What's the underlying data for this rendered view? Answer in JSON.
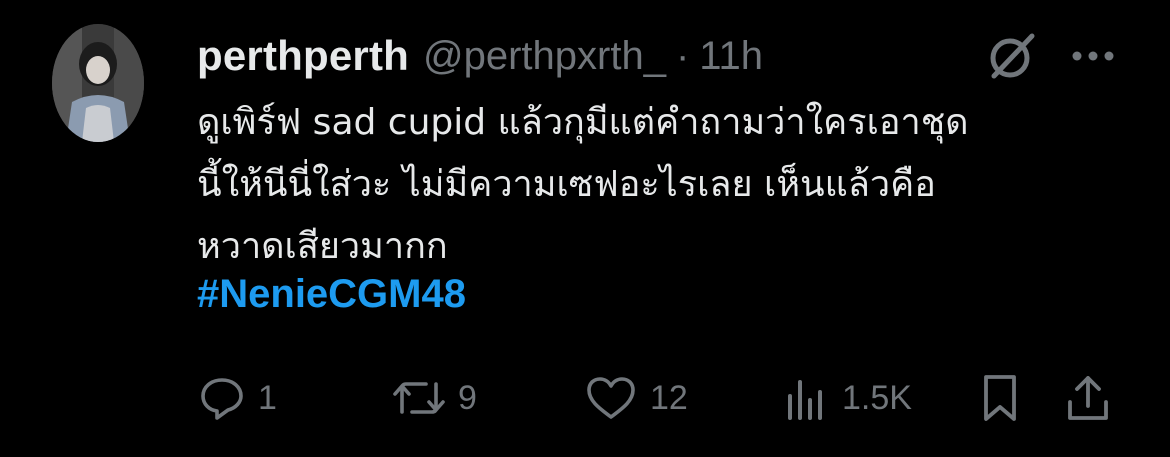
{
  "tweet": {
    "display_name": "perthperth",
    "handle": "@perthpxrth_",
    "separator": "·",
    "time": "11h",
    "text_lines": [
      "ดูเพิร์ฟ sad cupid แล้วกุมีแต่คำถามว่าใครเอาชุด",
      "นี้ให้นีนี่ใส่วะ ไม่มีความเซฟอะไรเลย เห็นแล้วคือ",
      "หวาดเสียวมากก"
    ],
    "hashtag": "#NenieCGM48"
  },
  "actions": {
    "reply_count": "1",
    "repost_count": "9",
    "like_count": "12",
    "views_count": "1.5K"
  },
  "icons": {
    "grok": "grok-icon",
    "more": "more-icon",
    "reply": "reply-icon",
    "repost": "repost-icon",
    "like": "heart-icon",
    "views": "views-icon",
    "bookmark": "bookmark-icon",
    "share": "share-icon"
  },
  "colors": {
    "background": "#000000",
    "text": "#e7e9ea",
    "secondary": "#71767b",
    "hashtag": "#1d9bf0"
  }
}
